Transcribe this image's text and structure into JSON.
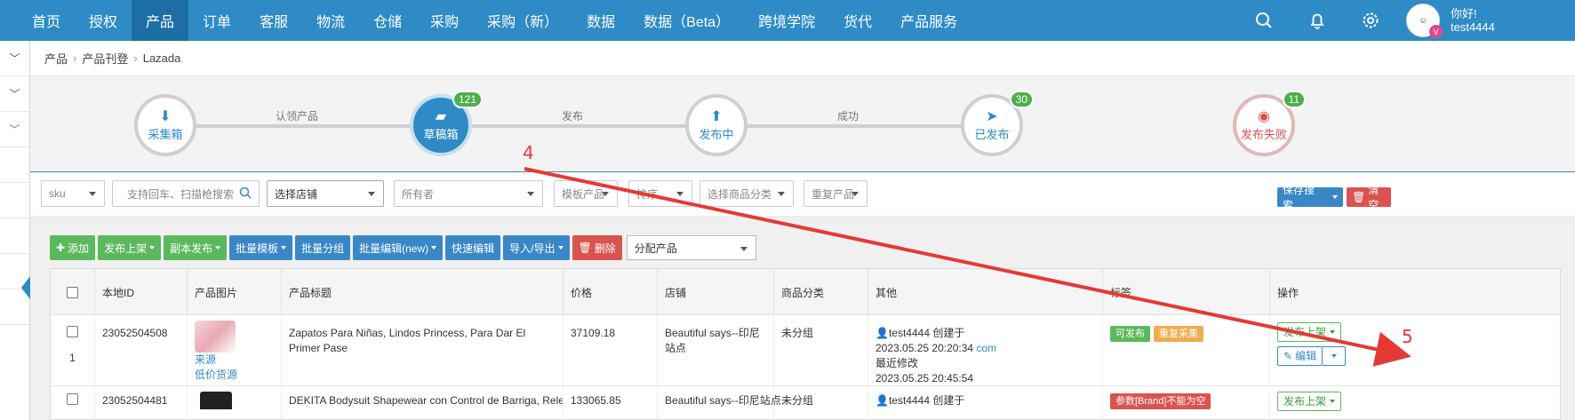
{
  "topnav": {
    "items": [
      "首页",
      "授权",
      "产品",
      "订单",
      "客服",
      "物流",
      "仓储",
      "采购",
      "采购（新）",
      "数据",
      "数据（Beta）",
      "跨境学院",
      "货代",
      "产品服务"
    ],
    "active_index": 2,
    "user": {
      "greeting": "你好!",
      "name": "test4444",
      "badge": "V"
    }
  },
  "breadcrumb": [
    "产品",
    "产品刊登",
    "Lazada"
  ],
  "workflow": {
    "steps": [
      {
        "label": "采集箱",
        "badge": ""
      },
      {
        "label": "草稿箱",
        "badge": "121"
      },
      {
        "label": "发布中",
        "badge": ""
      },
      {
        "label": "已发布",
        "badge": "30"
      },
      {
        "label": "发布失败",
        "badge": "11"
      }
    ],
    "transitions": [
      "认领产品",
      "发布",
      "成功"
    ]
  },
  "filters": {
    "sku": "sku",
    "search_placeholder": "支持回车、扫描枪搜索",
    "store": "选择店铺",
    "owner": "所有者",
    "template": "模板产品",
    "sort": "排序",
    "category": "选择商品分类",
    "duplicate": "重复产品",
    "save_search": "保存搜索",
    "clear": "清空"
  },
  "toolbar": {
    "add": "添加",
    "publish": "发布上架",
    "copy_publish": "副本发布",
    "batch_template": "批量模板",
    "batch_group": "批量分组",
    "batch_edit": "批量编辑(new)",
    "quick_edit": "快速编辑",
    "import_export": "导入/导出",
    "delete": "删除",
    "assign": "分配产品"
  },
  "table": {
    "headers": [
      "本地ID",
      "产品图片",
      "产品标题",
      "价格",
      "店铺",
      "商品分类",
      "其他",
      "标签",
      "操作"
    ],
    "rows": [
      {
        "index": "1",
        "id": "23052504508",
        "image_links": [
          "来源",
          "低价货源"
        ],
        "title": "Zapatos Para Niñas, Lindos Princess, Para Dar El Primer Pase",
        "price": "37109.18",
        "store": "Beautiful says--印尼站点",
        "category": "未分组",
        "creator": "test4444 创建于",
        "created": "2023.05.25 20:20:34",
        "created_link": "com",
        "modified_label": "最近修改",
        "modified": "2023.05.25 20:45:54",
        "tags": [
          "可发布",
          "重复采集"
        ],
        "op_publish": "发布上架",
        "op_edit": "编辑"
      },
      {
        "index": "",
        "id": "23052504481",
        "image_links": [],
        "title": "DEKITA Bodysuit Shapewear con Control de Barriga, Release B",
        "price": "133065.85",
        "store": "Beautiful says--印尼站点",
        "category": "未分组",
        "creator": "test4444 创建于",
        "created": "",
        "created_link": "",
        "modified_label": "",
        "modified": "",
        "tags": [
          "参数[Brand]不能为空"
        ],
        "op_publish": "发布上架",
        "op_edit": ""
      }
    ]
  },
  "annotations": [
    "4",
    "5"
  ],
  "colors": {
    "nav": "#2e8bc6",
    "accent_green": "#5cb85c",
    "accent_red": "#d9534f",
    "arrow": "#e53935"
  }
}
